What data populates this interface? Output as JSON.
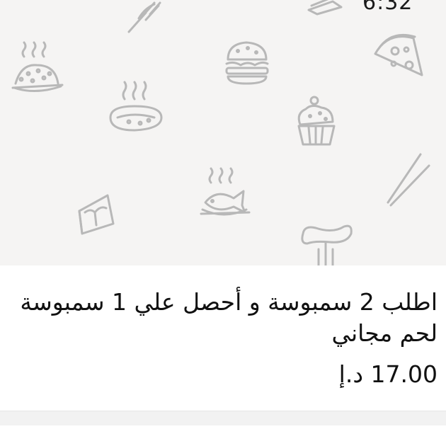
{
  "status": {
    "time_partial": "6:32"
  },
  "hero": {
    "background_color": "#f5f4f3",
    "doodle_color": "#b8b8b8",
    "icons": [
      "fork-icon",
      "sandwich-icon",
      "rice-bowl-icon",
      "burger-icon",
      "pizza-slice-icon",
      "hot-dog-dish-icon",
      "cupcake-icon",
      "chopsticks-icon",
      "cake-slice-icon",
      "fish-dish-icon",
      "sausage-fork-icon"
    ]
  },
  "product": {
    "title": "اطلب 2 سمبوسة و أحصل علي 1 سمبوسة لحم مجاني",
    "price": "17.00 د.إ"
  },
  "colors": {
    "text": "#111111",
    "divider": "#f2f2f2"
  }
}
